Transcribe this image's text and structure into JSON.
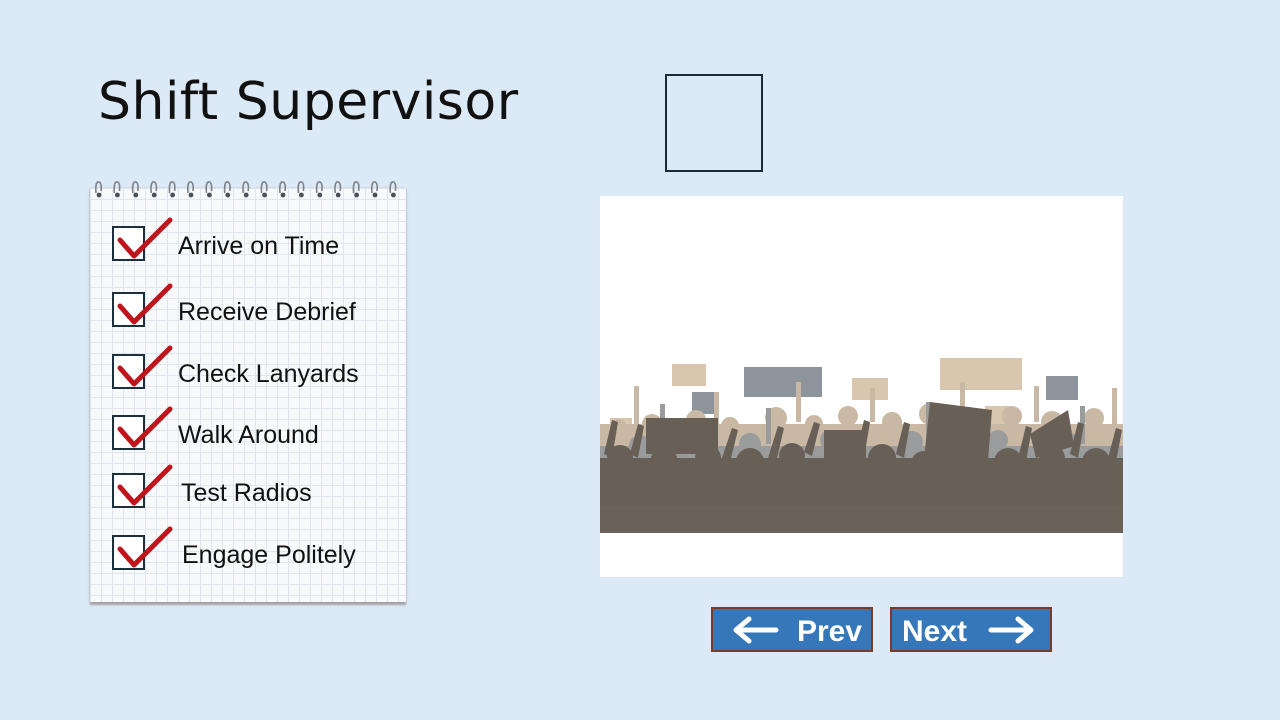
{
  "slide": {
    "title": "Shift Supervisor"
  },
  "checklist": [
    {
      "label": "Arrive on Time",
      "checked": true
    },
    {
      "label": "Receive Debrief",
      "checked": true
    },
    {
      "label": "Check Lanyards",
      "checked": true
    },
    {
      "label": "Walk Around",
      "checked": true
    },
    {
      "label": "Test Radios",
      "checked": true
    },
    {
      "label": "Engage Politely",
      "checked": true
    }
  ],
  "navigation": {
    "prev_label": "Prev",
    "next_label": "Next"
  },
  "colors": {
    "background": "#dce9f6",
    "button": "#3577b8",
    "button_border": "#7a3b25",
    "check": "#c0141c",
    "crowd_dark": "#685f56",
    "crowd_light": "#d8c6af",
    "crowd_grey": "#8e949b"
  },
  "icons": {
    "prev": "arrow-left-icon",
    "next": "arrow-right-icon",
    "check": "checkmark-icon"
  }
}
